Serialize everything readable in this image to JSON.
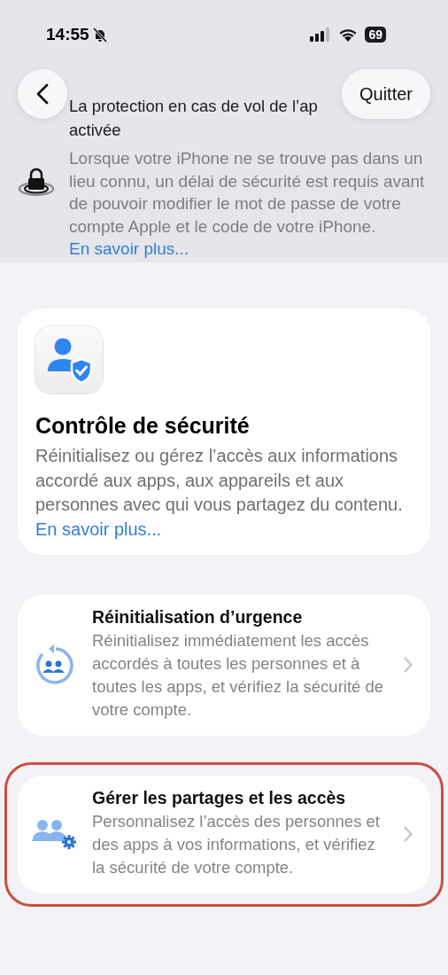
{
  "status_bar": {
    "time": "14:55",
    "battery": "69"
  },
  "nav": {
    "action": "Quitter"
  },
  "banner": {
    "title_lines": [
      "La protection en cas de vol de l’ap",
      "activée"
    ],
    "text": "Lorsque votre iPhone ne se trouve pas dans un lieu connu, un délai de sécurité est requis avant de pouvoir modifier le mot de passe de votre compte Apple et le code de votre iPhone.",
    "link": "En savoir plus..."
  },
  "hero": {
    "title": "Contrôle de sécurité",
    "text": "Réinitialisez ou gérez l’accès aux informations accordé aux apps, aux appareils et aux personnes avec qui vous partagez du contenu.",
    "link": "En savoir plus..."
  },
  "options": [
    {
      "kind": "reset",
      "title": "Réinitialisation d’urgence",
      "text": "Réinitialisez immédiatement les accès accordés à toutes les personnes et à toutes les apps, et vérifiez la sécurité de votre compte.",
      "highlighted": false
    },
    {
      "kind": "manage",
      "title": "Gérer les partages et les accès",
      "text": "Personnalisez l’accès des personnes et des apps à vos informations, et vérifiez la sécurité de votre compte.",
      "highlighted": true
    }
  ]
}
